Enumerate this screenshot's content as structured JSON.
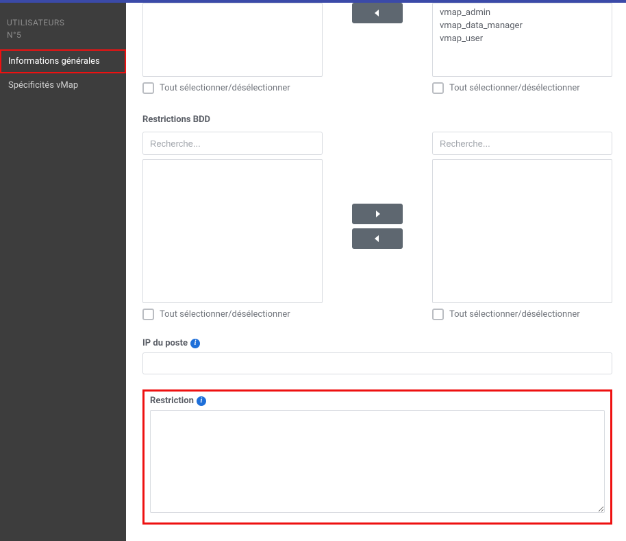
{
  "sidebar": {
    "header_line1": "UTILISATEURS",
    "header_line2": "N°5",
    "items": [
      {
        "label": "Informations générales",
        "active": true
      },
      {
        "label": "Spécificités vMap",
        "active": false
      }
    ]
  },
  "top_dual": {
    "right_items": [
      "vmap_admin",
      "vmap_data_manager",
      "vmap_user"
    ],
    "select_all_label": "Tout sélectionner/désélectionner"
  },
  "restrictions_bdd": {
    "title": "Restrictions BDD",
    "search_placeholder": "Recherche...",
    "select_all_label": "Tout sélectionner/désélectionner"
  },
  "ip_field": {
    "label": "IP du poste",
    "value": ""
  },
  "restriction_field": {
    "label": "Restriction",
    "value": ""
  }
}
